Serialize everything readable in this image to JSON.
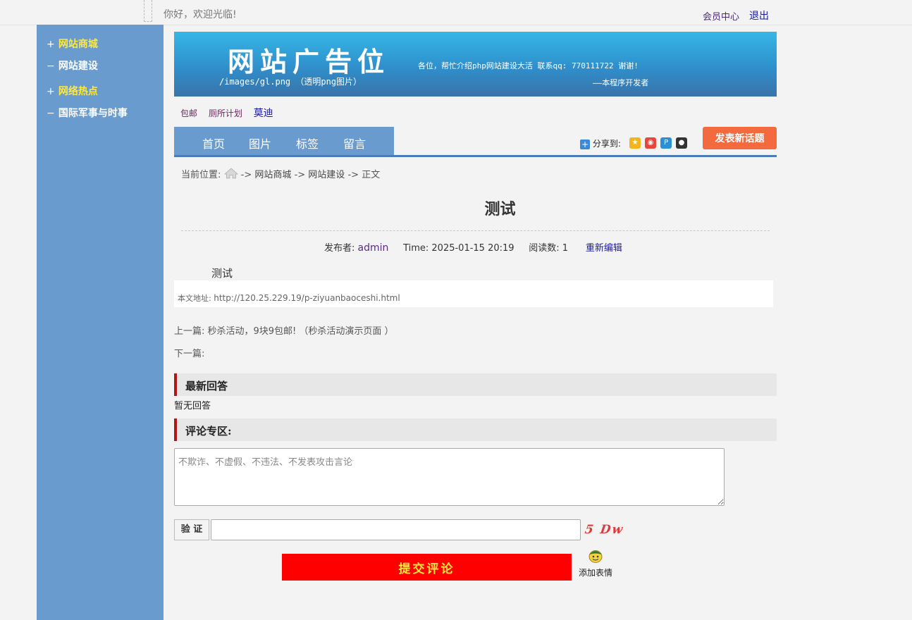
{
  "header": {
    "welcome": "你好，欢迎光临!",
    "member_center": "会员中心",
    "logout": "退出"
  },
  "sidebar": {
    "items": [
      {
        "mark": "+",
        "label": "网站商城"
      },
      {
        "mark": "−",
        "label": "网站建设"
      },
      {
        "mark": "+",
        "label": "网络热点"
      },
      {
        "mark": "−",
        "label": "国际军事与时事"
      }
    ]
  },
  "banner": {
    "title": "网站广告位",
    "path": "/images/gl.png （透明png图片）",
    "message": "各位，帮忙介绍php网站建设大活  联系qq: 770111722 谢谢!",
    "developer": "——本程序开发者"
  },
  "tags": [
    "包邮",
    "厕所计划",
    "莫迪"
  ],
  "nav": {
    "items": [
      "首页",
      "图片",
      "标签",
      "留言"
    ],
    "share_label": "分享到:",
    "new_topic": "发表新话题"
  },
  "breadcrumb": {
    "prefix": "当前位置:",
    "sep": "->",
    "items": [
      "网站商城",
      "网站建设",
      "正文"
    ]
  },
  "article": {
    "title": "测试",
    "author_label": "发布者:",
    "author": "admin",
    "time": "Time: 2025-01-15 20:19",
    "reads_label": "阅读数:",
    "reads": "1",
    "edit": "重新编辑",
    "body": "测试",
    "url_label": "本文地址:",
    "url": "http://120.25.229.19/p-ziyuanbaoceshi.html",
    "prev": "上一篇: 秒杀活动，9块9包邮! （秒杀活动演示页面 ）",
    "next": "下一篇:"
  },
  "replies": {
    "heading": "最新回答",
    "empty": "暂无回答"
  },
  "comment": {
    "heading": "评论专区:",
    "placeholder": "不欺诈、不虚假、不违法、不发表攻击言论",
    "verify_label": "验 证",
    "captcha": "5 Dw",
    "submit": "提交评论",
    "emoji": "添加表情"
  },
  "colors": {
    "sidebar": "#6a9bcf",
    "highlight_yellow": "#ffe93a",
    "new_topic": "#f26a3e",
    "submit": "#ff0000",
    "section_border": "#b01818"
  }
}
